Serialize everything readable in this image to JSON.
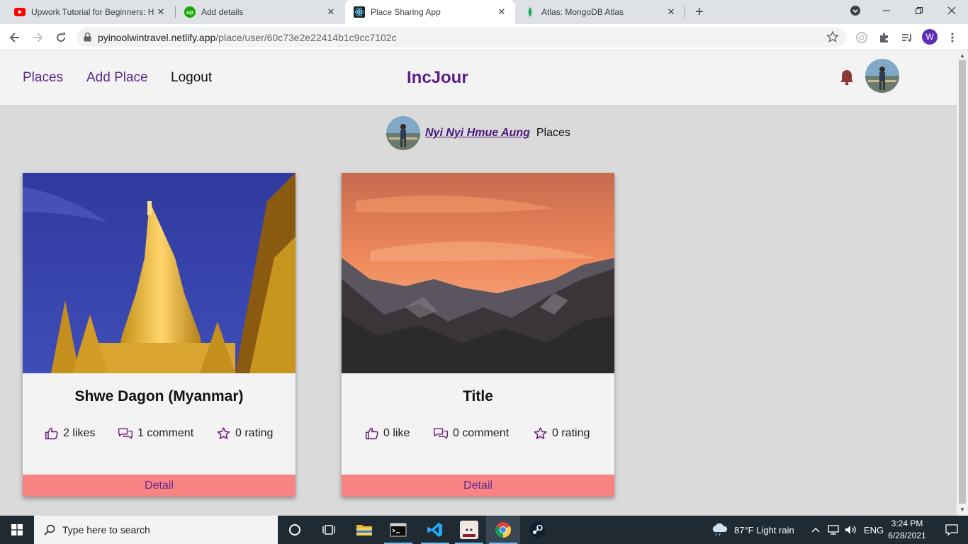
{
  "browser": {
    "tabs": [
      {
        "title": "Upwork Tutorial for Beginners: H",
        "icon": "youtube-icon",
        "active": false
      },
      {
        "title": "Add details",
        "icon": "upwork-icon",
        "active": false
      },
      {
        "title": "Place Sharing App",
        "icon": "react-icon",
        "active": true
      },
      {
        "title": "Atlas: MongoDB Atlas",
        "icon": "mongodb-leaf-icon",
        "active": false
      }
    ],
    "close_glyph": "✕",
    "new_tab_glyph": "+",
    "url_host": "pyinoolwintravel.netlify.app",
    "url_path": "/place/user/60c73e2e22414b1c9cc7102c",
    "profile_initial": "W"
  },
  "app": {
    "nav": {
      "places": "Places",
      "add_place": "Add Place",
      "logout": "Logout"
    },
    "brand": "IncJour",
    "bell_color": "#8b3a3a",
    "accent_color": "#5a1e8c"
  },
  "user": {
    "name": "Nyi Nyi Hmue Aung",
    "suffix": "Places"
  },
  "cards": [
    {
      "title": "Shwe Dagon (Myanmar)",
      "likes": "2 likes",
      "comments": "1 comment",
      "rating": "0 rating",
      "detail": "Detail",
      "image": "golden-pagoda-photo"
    },
    {
      "title": "Title",
      "likes": "0 like",
      "comments": "0 comment",
      "rating": "0 rating",
      "detail": "Detail",
      "image": "mountain-sunset-photo"
    }
  ],
  "taskbar": {
    "search_placeholder": "Type here to search",
    "weather": "87°F  Light rain",
    "language": "ENG",
    "time": "3:24 PM",
    "date": "6/28/2021"
  }
}
